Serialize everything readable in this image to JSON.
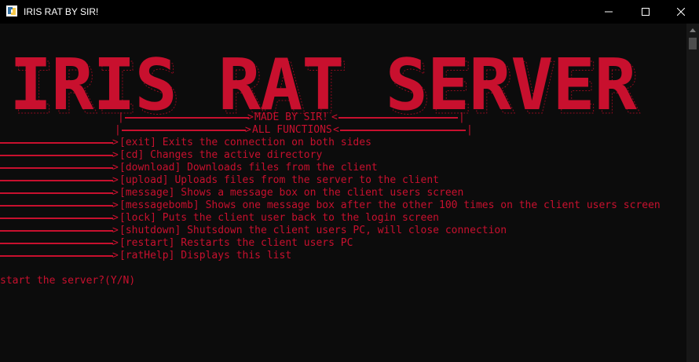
{
  "window": {
    "title": "IRIS RAT BY SIR!"
  },
  "banner": {
    "text": "IRIS RAT SERVER",
    "color": "#c8102e"
  },
  "headers": {
    "made_by": "MADE BY SIR!",
    "all_functions": "ALL FUNCTIONS"
  },
  "functions": [
    {
      "text": "[exit] Exits the connection on both sides"
    },
    {
      "text": "[cd] Changes the active directory"
    },
    {
      "text": "[download] Downloads files from the client"
    },
    {
      "text": "[upload] Uploads files from the server to the client"
    },
    {
      "text": "[message] Shows a message box on the client users screen"
    },
    {
      "text": "[messagebomb] Shows one message box after the other 100 times on the client users screen"
    },
    {
      "text": "[lock] Puts the client user back to the login screen"
    },
    {
      "text": "[shutdown] Shutsdown the client users PC, will close connection"
    },
    {
      "text": "[restart] Restarts the client users PC"
    },
    {
      "text": "[ratHelp] Displays this list"
    }
  ],
  "prompt": {
    "text": "start the server?(Y/N)"
  },
  "colors": {
    "accent": "#c8102e",
    "background": "#0c0c0c"
  }
}
